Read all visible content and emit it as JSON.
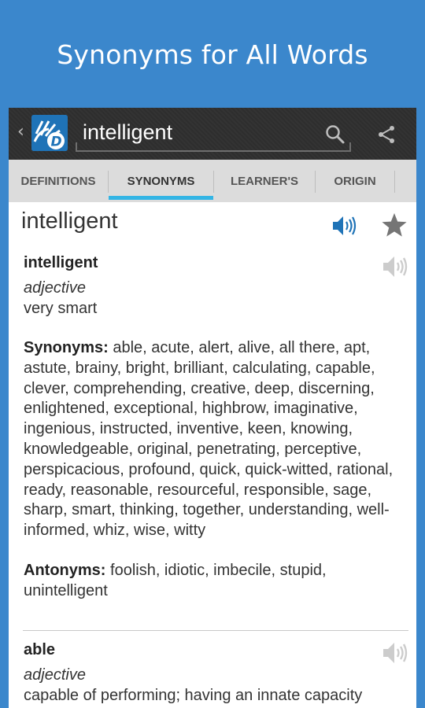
{
  "banner": {
    "title": "Synonyms for All Words"
  },
  "actionbar": {
    "back_glyph": "‹",
    "search_value": "intelligent"
  },
  "tabs": [
    {
      "label": "DEFINITIONS",
      "active": false
    },
    {
      "label": "SYNONYMS",
      "active": true
    },
    {
      "label": "LEARNER'S",
      "active": false
    },
    {
      "label": "ORIGIN",
      "active": false
    }
  ],
  "headword": "intelligent",
  "entries": [
    {
      "word": "intelligent",
      "pos": "adjective",
      "definition": "very smart",
      "synonyms_label": "Synonyms:",
      "synonyms": " able, acute, alert, alive, all there, apt, astute, brainy, bright, brilliant, calculating, capable, clever, comprehending, creative, deep, discerning, enlightened, exceptional, highbrow, imaginative, ingenious, instructed, inventive, keen, knowing, knowledgeable, original, penetrating, perceptive, perspicacious, profound, quick, quick-witted, rational, ready, reasonable, resourceful, responsible, sage, sharp, smart, thinking, together, understanding, well-informed, whiz, wise, witty",
      "antonyms_label": "Antonyms:",
      "antonyms": " foolish, idiotic, imbecile, stupid, unintelligent"
    },
    {
      "word": "able",
      "pos": "adjective",
      "definition": "capable of performing; having an innate capacity"
    }
  ],
  "icons": {
    "logo": "dictionary-logo-icon",
    "search": "search-icon",
    "share": "share-icon",
    "audio_active": "speaker-icon",
    "audio_inactive": "speaker-icon",
    "favorite": "star-icon"
  },
  "colors": {
    "background": "#3b87cc",
    "actionbar": "#2e2e2e",
    "tab_indicator": "#33b5e5",
    "speaker_active": "#1f73b7"
  }
}
